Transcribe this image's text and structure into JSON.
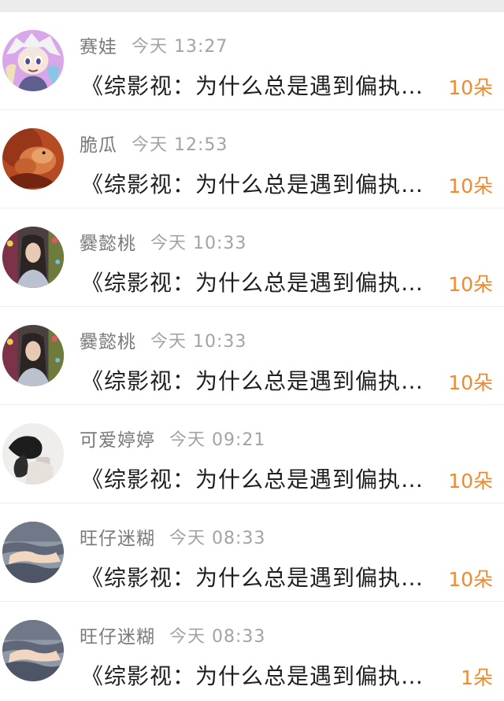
{
  "rows": [
    {
      "name": "赛娃",
      "time": "今天 13:27",
      "message": "《综影视：为什么总是遇到偏执…",
      "count": "10朵",
      "avatar_icon": "anime-character-avatar-icon",
      "avatar_colors": [
        "#d7a6ea",
        "#f4f4f4",
        "#5e5e8a"
      ]
    },
    {
      "name": "脆瓜",
      "time": "今天 12:53",
      "message": "《综影视：为什么总是遇到偏执…",
      "count": "10朵",
      "avatar_icon": "creature-photo-avatar-icon",
      "avatar_colors": [
        "#b84b22",
        "#e27a45",
        "#7b2412"
      ]
    },
    {
      "name": "爨懿桃",
      "time": "今天 10:33",
      "message": "《综影视：为什么总是遇到偏执…",
      "count": "10朵",
      "avatar_icon": "portrait-girl-avatar-icon",
      "avatar_colors": [
        "#6a5a5a",
        "#2c2c2c",
        "#b58b6e"
      ]
    },
    {
      "name": "爨懿桃",
      "time": "今天 10:33",
      "message": "《综影视：为什么总是遇到偏执…",
      "count": "10朵",
      "avatar_icon": "portrait-girl-avatar-icon",
      "avatar_colors": [
        "#6a5a5a",
        "#2c2c2c",
        "#b58b6e"
      ]
    },
    {
      "name": "可爱婷婷",
      "time": "今天 09:21",
      "message": "《综影视：为什么总是遇到偏执…",
      "count": "10朵",
      "avatar_icon": "monochrome-portrait-avatar-icon",
      "avatar_colors": [
        "#f1efee",
        "#1e1e1e",
        "#d4cbc6"
      ]
    },
    {
      "name": "旺仔迷糊",
      "time": "今天 08:33",
      "message": "《综影视：为什么总是遇到偏执…",
      "count": "10朵",
      "avatar_icon": "sunset-clouds-avatar-icon",
      "avatar_colors": [
        "#8f98a6",
        "#4d5566",
        "#f2d7bf"
      ]
    },
    {
      "name": "旺仔迷糊",
      "time": "今天 08:33",
      "message": "《综影视：为什么总是遇到偏执…",
      "count": "1朵",
      "avatar_icon": "sunset-clouds-avatar-icon",
      "avatar_colors": [
        "#8f98a6",
        "#4d5566",
        "#f2d7bf"
      ]
    }
  ],
  "accent_color": "#f08a2e"
}
